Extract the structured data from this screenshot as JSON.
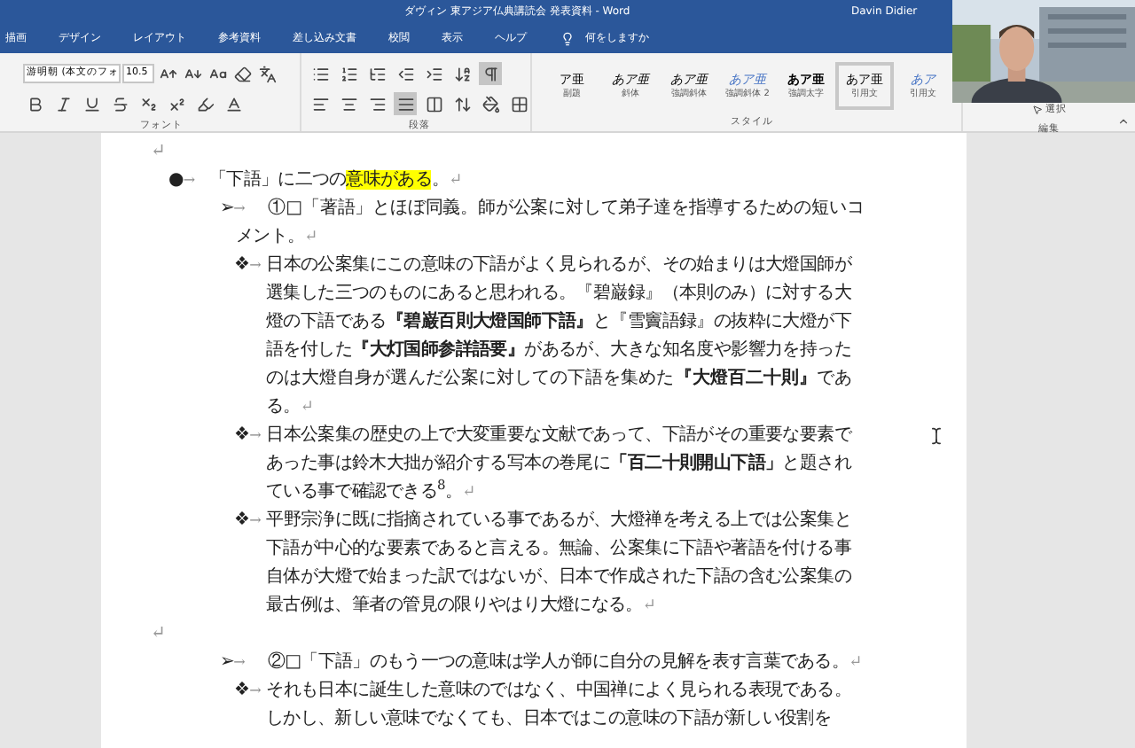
{
  "window": {
    "title": "ダヴィン 東アジア仏典講読会 発表資料 - Word",
    "user": "Davin Didier"
  },
  "ribbon_tabs": [
    {
      "label": "描画",
      "selected": false
    },
    {
      "label": "デザイン",
      "selected": false
    },
    {
      "label": "レイアウト",
      "selected": false
    },
    {
      "label": "参考資料",
      "selected": false
    },
    {
      "label": "差し込み文書",
      "selected": false
    },
    {
      "label": "校閲",
      "selected": false
    },
    {
      "label": "表示",
      "selected": false
    },
    {
      "label": "ヘルプ",
      "selected": false
    }
  ],
  "tell_me": {
    "placeholder": "何をしますか"
  },
  "font_group": {
    "font_name": "游明朝 (本文のフォ",
    "font_size": "10.5",
    "label": "フォント"
  },
  "paragraph_group": {
    "label": "段落",
    "show_marks": true,
    "align_buttons": [
      {
        "kind": "left",
        "selected": false
      },
      {
        "kind": "center",
        "selected": false
      },
      {
        "kind": "right",
        "selected": false
      },
      {
        "kind": "justify",
        "selected": true
      }
    ]
  },
  "styles_group": {
    "label": "スタイル",
    "styles": [
      {
        "preview": "ア亜",
        "name": "副題",
        "kind": "plain",
        "selected": false
      },
      {
        "preview": "あア亜",
        "name": "斜体",
        "kind": "italic",
        "selected": false
      },
      {
        "preview": "あア亜",
        "name": "強調斜体",
        "kind": "italic",
        "selected": false
      },
      {
        "preview": "あア亜",
        "name": "強調斜体 2",
        "kind": "blue",
        "selected": false
      },
      {
        "preview": "あア亜",
        "name": "強調太字",
        "kind": "bold",
        "selected": false
      },
      {
        "preview": "あア亜",
        "name": "引用文",
        "kind": "plain",
        "selected": true
      },
      {
        "preview": "あア",
        "name": "引用文",
        "kind": "blue",
        "selected": false
      }
    ]
  },
  "editing_group": {
    "select": "選択",
    "label": "編集"
  },
  "document": {
    "paragraphs": [
      {
        "kind": "empty",
        "return_mark": "↵"
      },
      {
        "kind": "item",
        "marker": "●",
        "tab": "→",
        "segments": [
          {
            "text": "「下語」に二つの",
            "highlight": false
          },
          {
            "text": "意味がある",
            "highlight": true
          },
          {
            "text": "。",
            "highlight": false
          }
        ],
        "return_mark": "↵",
        "children": [
          {
            "kind": "item",
            "marker": "➢",
            "tab": "→",
            "segments": [
              {
                "text": "①□「著語」とほぼ同義。師が公案に対して弟子達を指導するための短いコメント。",
                "highlight": false
              }
            ],
            "return_mark": "↵",
            "children": [
              {
                "kind": "item",
                "marker": "❖",
                "tab": "→",
                "segments": [
                  {
                    "text": "日本の公案集にこの意味の下語がよく見られるが、その始まりは大燈国師が選集した三つのものにあると思われる。『碧巌録』（本則のみ）に対する大燈の下語である**『碧巌百則大燈国師下語』**と『雪竇語録』の抜粋に大燈が下語を付した**『大灯国師参詳語要』**があるが、大きな知名度や影響力を持ったのは大燈自身が選んだ公案に対しての下語を集めた**『大燈百二十則』**である。",
                    "highlight": false
                  }
                ],
                "return_mark": "↵"
              },
              {
                "kind": "item",
                "marker": "❖",
                "tab": "→",
                "segments": [
                  {
                    "text": "日本公案集の歴史の上で大変重要な文献であって、下語がその重要な要素であった事は鈴木大拙が紹介する写本の巻尾に**「百二十則開山下語」**と題されている事で確認できる$^{8}$。",
                    "highlight": false
                  }
                ],
                "return_mark": "↵"
              },
              {
                "kind": "item",
                "marker": "❖",
                "tab": "→",
                "segments": [
                  {
                    "text": "平野宗浄に既に指摘されている事であるが、大燈禅を考える上では公案集と下語が中心的な要素であると言える。無論、公案集に下語や著語を付ける事自体が大燈で始まった訳ではないが、日本で作成された下語の含む公案集の最古例は、筆者の管見の限りやはり大燈になる。",
                    "highlight": false
                  }
                ],
                "return_mark": "↵"
              }
            ]
          },
          {
            "kind": "empty",
            "return_mark": "↵"
          },
          {
            "kind": "item",
            "marker": "➢",
            "tab": "→",
            "segments": [
              {
                "text": "②□「下語」のもう一つの意味は学人が師に自分の見解を表す言葉である。",
                "highlight": false
              }
            ],
            "return_mark": "↵",
            "children": [
              {
                "kind": "item",
                "marker": "❖",
                "tab": "→",
                "segments": [
                  {
                    "text": "それも日本に誕生した意味のではなく、中国禅によく見られる表現である。しかし、新しい意味でなくても、日本ではこの意味の下語が新しい役割を",
                    "highlight": false
                  }
                ]
              }
            ]
          }
        ]
      }
    ]
  }
}
